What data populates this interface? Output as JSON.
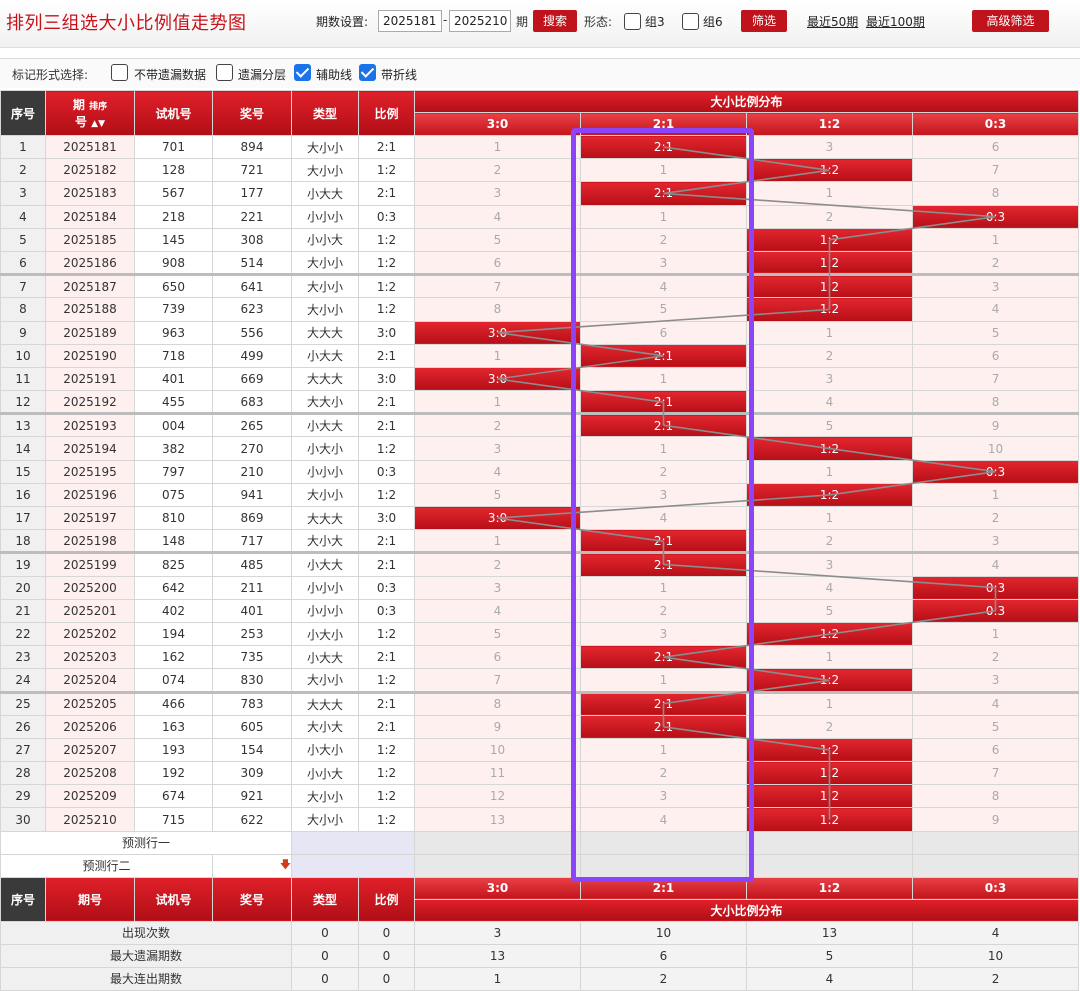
{
  "header": {
    "title": "排列三组选大小比例值走势图",
    "period_label": "期数设置:",
    "period_from": "2025181",
    "period_dash": "-",
    "period_to": "2025210",
    "period_unit": "期",
    "search_label": "搜索",
    "form_label": "形态:",
    "group3_label": "组3",
    "group6_label": "组6",
    "filter_label": "筛选",
    "recent50_label": "最近50期",
    "recent100_label": "最近100期",
    "advanced_label": "高级筛选"
  },
  "marks": {
    "title": "标记形式选择:",
    "options": [
      {
        "label": "不带遗漏数据",
        "checked": false
      },
      {
        "label": "遗漏分层",
        "checked": false
      },
      {
        "label": "辅助线",
        "checked": true
      },
      {
        "label": "带折线",
        "checked": true
      }
    ]
  },
  "table": {
    "headers": {
      "seq": "序号",
      "period_a": "期",
      "period_b": "号",
      "sort": "排序",
      "trial": "试机号",
      "prize": "奖号",
      "type": "类型",
      "ratio": "比例",
      "dist": "大小比例分布",
      "dist_cols": [
        "3:0",
        "2:1",
        "1:2",
        "0:3"
      ]
    },
    "rows": [
      {
        "seq": "1",
        "period": "2025181",
        "trial": "701",
        "prize": "894",
        "type": "大小小",
        "ratio": "2:1",
        "dist": [
          "1",
          "2:1",
          "3",
          "6"
        ]
      },
      {
        "seq": "2",
        "period": "2025182",
        "trial": "128",
        "prize": "721",
        "type": "大小小",
        "ratio": "1:2",
        "dist": [
          "2",
          "1",
          "1:2",
          "7"
        ]
      },
      {
        "seq": "3",
        "period": "2025183",
        "trial": "567",
        "prize": "177",
        "type": "小大大",
        "ratio": "2:1",
        "dist": [
          "3",
          "2:1",
          "1",
          "8"
        ]
      },
      {
        "seq": "4",
        "period": "2025184",
        "trial": "218",
        "prize": "221",
        "type": "小小小",
        "ratio": "0:3",
        "dist": [
          "4",
          "1",
          "2",
          "0:3"
        ]
      },
      {
        "seq": "5",
        "period": "2025185",
        "trial": "145",
        "prize": "308",
        "type": "小小大",
        "ratio": "1:2",
        "dist": [
          "5",
          "2",
          "1:2",
          "1"
        ]
      },
      {
        "seq": "6",
        "period": "2025186",
        "trial": "908",
        "prize": "514",
        "type": "大小小",
        "ratio": "1:2",
        "dist": [
          "6",
          "3",
          "1:2",
          "2"
        ]
      },
      {
        "seq": "7",
        "period": "2025187",
        "trial": "650",
        "prize": "641",
        "type": "大小小",
        "ratio": "1:2",
        "dist": [
          "7",
          "4",
          "1:2",
          "3"
        ]
      },
      {
        "seq": "8",
        "period": "2025188",
        "trial": "739",
        "prize": "623",
        "type": "大小小",
        "ratio": "1:2",
        "dist": [
          "8",
          "5",
          "1:2",
          "4"
        ]
      },
      {
        "seq": "9",
        "period": "2025189",
        "trial": "963",
        "prize": "556",
        "type": "大大大",
        "ratio": "3:0",
        "dist": [
          "3:0",
          "6",
          "1",
          "5"
        ]
      },
      {
        "seq": "10",
        "period": "2025190",
        "trial": "718",
        "prize": "499",
        "type": "小大大",
        "ratio": "2:1",
        "dist": [
          "1",
          "2:1",
          "2",
          "6"
        ]
      },
      {
        "seq": "11",
        "period": "2025191",
        "trial": "401",
        "prize": "669",
        "type": "大大大",
        "ratio": "3:0",
        "dist": [
          "3:0",
          "1",
          "3",
          "7"
        ]
      },
      {
        "seq": "12",
        "period": "2025192",
        "trial": "455",
        "prize": "683",
        "type": "大大小",
        "ratio": "2:1",
        "dist": [
          "1",
          "2:1",
          "4",
          "8"
        ]
      },
      {
        "seq": "13",
        "period": "2025193",
        "trial": "004",
        "prize": "265",
        "type": "小大大",
        "ratio": "2:1",
        "dist": [
          "2",
          "2:1",
          "5",
          "9"
        ]
      },
      {
        "seq": "14",
        "period": "2025194",
        "trial": "382",
        "prize": "270",
        "type": "小大小",
        "ratio": "1:2",
        "dist": [
          "3",
          "1",
          "1:2",
          "10"
        ]
      },
      {
        "seq": "15",
        "period": "2025195",
        "trial": "797",
        "prize": "210",
        "type": "小小小",
        "ratio": "0:3",
        "dist": [
          "4",
          "2",
          "1",
          "0:3"
        ]
      },
      {
        "seq": "16",
        "period": "2025196",
        "trial": "075",
        "prize": "941",
        "type": "大小小",
        "ratio": "1:2",
        "dist": [
          "5",
          "3",
          "1:2",
          "1"
        ]
      },
      {
        "seq": "17",
        "period": "2025197",
        "trial": "810",
        "prize": "869",
        "type": "大大大",
        "ratio": "3:0",
        "dist": [
          "3:0",
          "4",
          "1",
          "2"
        ]
      },
      {
        "seq": "18",
        "period": "2025198",
        "trial": "148",
        "prize": "717",
        "type": "大小大",
        "ratio": "2:1",
        "dist": [
          "1",
          "2:1",
          "2",
          "3"
        ]
      },
      {
        "seq": "19",
        "period": "2025199",
        "trial": "825",
        "prize": "485",
        "type": "小大大",
        "ratio": "2:1",
        "dist": [
          "2",
          "2:1",
          "3",
          "4"
        ]
      },
      {
        "seq": "20",
        "period": "2025200",
        "trial": "642",
        "prize": "211",
        "type": "小小小",
        "ratio": "0:3",
        "dist": [
          "3",
          "1",
          "4",
          "0:3"
        ]
      },
      {
        "seq": "21",
        "period": "2025201",
        "trial": "402",
        "prize": "401",
        "type": "小小小",
        "ratio": "0:3",
        "dist": [
          "4",
          "2",
          "5",
          "0:3"
        ]
      },
      {
        "seq": "22",
        "period": "2025202",
        "trial": "194",
        "prize": "253",
        "type": "小大小",
        "ratio": "1:2",
        "dist": [
          "5",
          "3",
          "1:2",
          "1"
        ]
      },
      {
        "seq": "23",
        "period": "2025203",
        "trial": "162",
        "prize": "735",
        "type": "小大大",
        "ratio": "2:1",
        "dist": [
          "6",
          "2:1",
          "1",
          "2"
        ]
      },
      {
        "seq": "24",
        "period": "2025204",
        "trial": "074",
        "prize": "830",
        "type": "大小小",
        "ratio": "1:2",
        "dist": [
          "7",
          "1",
          "1:2",
          "3"
        ]
      },
      {
        "seq": "25",
        "period": "2025205",
        "trial": "466",
        "prize": "783",
        "type": "大大大",
        "ratio": "2:1",
        "dist": [
          "8",
          "2:1",
          "1",
          "4"
        ]
      },
      {
        "seq": "26",
        "period": "2025206",
        "trial": "163",
        "prize": "605",
        "type": "大小大",
        "ratio": "2:1",
        "dist": [
          "9",
          "2:1",
          "2",
          "5"
        ]
      },
      {
        "seq": "27",
        "period": "2025207",
        "trial": "193",
        "prize": "154",
        "type": "小大小",
        "ratio": "1:2",
        "dist": [
          "10",
          "1",
          "1:2",
          "6"
        ]
      },
      {
        "seq": "28",
        "period": "2025208",
        "trial": "192",
        "prize": "309",
        "type": "小小大",
        "ratio": "1:2",
        "dist": [
          "11",
          "2",
          "1:2",
          "7"
        ]
      },
      {
        "seq": "29",
        "period": "2025209",
        "trial": "674",
        "prize": "921",
        "type": "大小小",
        "ratio": "1:2",
        "dist": [
          "12",
          "3",
          "1:2",
          "8"
        ]
      },
      {
        "seq": "30",
        "period": "2025210",
        "trial": "715",
        "prize": "622",
        "type": "大小小",
        "ratio": "1:2",
        "dist": [
          "13",
          "4",
          "1:2",
          "9"
        ]
      }
    ],
    "predict1": "预测行一",
    "predict2": "预测行二",
    "footer_headers": {
      "seq": "序号",
      "period": "期号",
      "trial": "试机号",
      "prize": "奖号",
      "type": "类型",
      "ratio": "比例",
      "dist": "大小比例分布",
      "dist_cols": [
        "3:0",
        "2:1",
        "1:2",
        "0:3"
      ]
    },
    "stats": [
      {
        "label": "出现次数",
        "type": "0",
        "ratio": "0",
        "values": [
          "3",
          "10",
          "13",
          "4"
        ]
      },
      {
        "label": "最大遗漏期数",
        "type": "0",
        "ratio": "0",
        "values": [
          "13",
          "6",
          "5",
          "10"
        ]
      },
      {
        "label": "最大连出期数",
        "type": "0",
        "ratio": "0",
        "values": [
          "1",
          "2",
          "4",
          "2"
        ]
      }
    ]
  },
  "colors": {
    "accent_red": "#c0141c",
    "highlight_purple": "#8b44f7",
    "trend_line": "#8c8c8c"
  }
}
